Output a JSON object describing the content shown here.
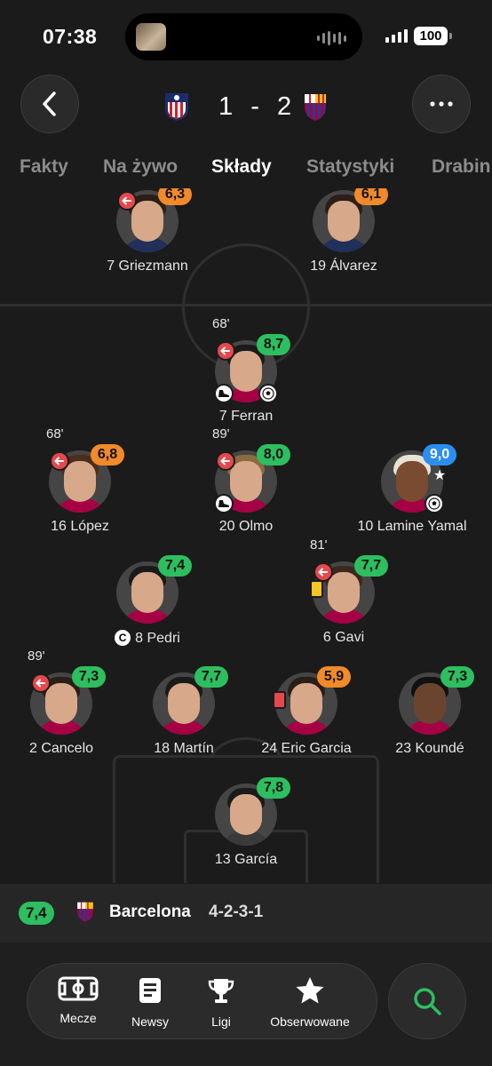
{
  "status": {
    "time": "07:38",
    "battery": "100"
  },
  "header": {
    "score_home": "1",
    "score_sep": "-",
    "score_away": "2"
  },
  "tabs": [
    {
      "label": "Fakty"
    },
    {
      "label": "Na żywo"
    },
    {
      "label": "Składy"
    },
    {
      "label": "Statystyki"
    },
    {
      "label": "Drabin"
    }
  ],
  "players": {
    "griezmann": {
      "name": "7 Griezmann",
      "rating": "6,3"
    },
    "alvarez": {
      "name": "19 Álvarez",
      "rating": "6,1"
    },
    "ferran": {
      "name": "7 Ferran",
      "rating": "8,7",
      "sub_time": "68'"
    },
    "lopez": {
      "name": "16 López",
      "rating": "6,8",
      "sub_time": "68'"
    },
    "olmo": {
      "name": "20 Olmo",
      "rating": "8,0",
      "sub_time": "89'"
    },
    "yamal": {
      "name": "10 Lamine Yamal",
      "rating": "9,0 ★"
    },
    "pedri": {
      "name": "8 Pedri",
      "rating": "7,4",
      "captain": "C"
    },
    "gavi": {
      "name": "6 Gavi",
      "rating": "7,7",
      "sub_time": "81'"
    },
    "cancelo": {
      "name": "2 Cancelo",
      "rating": "7,3",
      "sub_time": "89'"
    },
    "martin": {
      "name": "18 Martín",
      "rating": "7,7"
    },
    "ericgarcia": {
      "name": "24 Eric Garcia",
      "rating": "5,9"
    },
    "kounde": {
      "name": "23 Koundé",
      "rating": "7,3"
    },
    "garcia": {
      "name": "13 García",
      "rating": "7,8"
    }
  },
  "team": {
    "rating": "7,4",
    "name": "Barcelona",
    "formation": "4-2-3-1"
  },
  "nav": [
    {
      "label": "Mecze",
      "icon": "pitch-icon"
    },
    {
      "label": "Newsy",
      "icon": "news-icon"
    },
    {
      "label": "Ligi",
      "icon": "trophy-icon"
    },
    {
      "label": "Obserwowane",
      "icon": "star-icon"
    }
  ],
  "colors": {
    "rating_green": "#2dbe5f",
    "rating_orange": "#f08a2a",
    "rating_blue": "#2a8df0",
    "search_green": "#2dbe5f"
  }
}
